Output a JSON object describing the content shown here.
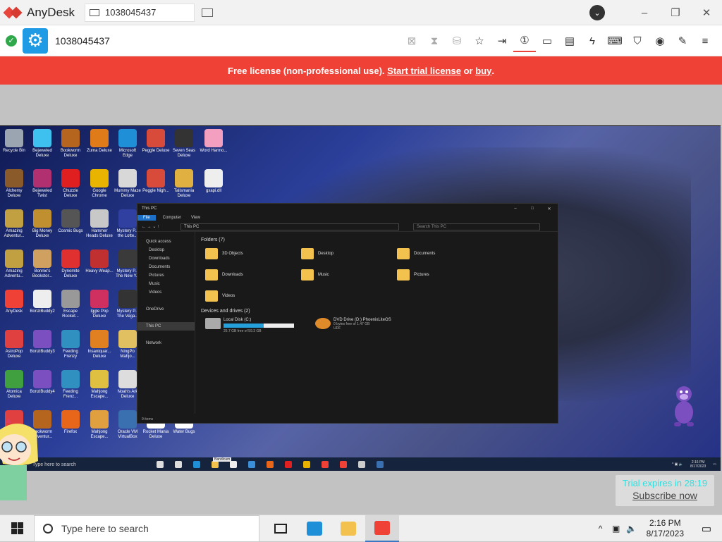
{
  "window": {
    "app_name": "AnyDesk",
    "tab_address": "1038045437",
    "profile_icon": "profile-icon",
    "controls": [
      "minimize-icon",
      "maximize-icon",
      "close-icon"
    ]
  },
  "toolbar": {
    "remote_id": "1038045437",
    "status_icon": "checkmark-icon",
    "tools": [
      {
        "name": "privacy-icon",
        "glyph": "⊠",
        "dim": true
      },
      {
        "name": "hourglass-icon",
        "glyph": "⧗",
        "dim": true
      },
      {
        "name": "database-icon",
        "glyph": "⛁",
        "dim": true
      },
      {
        "name": "favorite-star-icon",
        "glyph": "☆",
        "dim": false
      },
      {
        "name": "file-transfer-icon",
        "glyph": "⇥",
        "dim": false
      },
      {
        "name": "monitor-1-icon",
        "glyph": "①",
        "dim": false
      },
      {
        "name": "display-icon",
        "glyph": "▭",
        "dim": false
      },
      {
        "name": "chat-icon",
        "glyph": "▤",
        "dim": false
      },
      {
        "name": "actions-bolt-icon",
        "glyph": "ϟ",
        "dim": false
      },
      {
        "name": "keyboard-icon",
        "glyph": "⌨",
        "dim": false
      },
      {
        "name": "permissions-shield-icon",
        "glyph": "⛉",
        "dim": false
      },
      {
        "name": "record-icon",
        "glyph": "◉",
        "dim": false
      },
      {
        "name": "pen-icon",
        "glyph": "✎",
        "dim": false
      },
      {
        "name": "menu-icon",
        "glyph": "≡",
        "dim": false
      }
    ]
  },
  "banner": {
    "prefix": "Free license (non-professional use).",
    "trial_link": "Start trial license",
    "or": "or",
    "buy_link": "buy",
    "suffix": "."
  },
  "remote": {
    "desktop_icons": [
      {
        "label": "Recycle Bin",
        "color": "#9aa5b1"
      },
      {
        "label": "Bejeweled Deluxe",
        "color": "#3fc1f0"
      },
      {
        "label": "Bookworm Deluxe",
        "color": "#b5651d"
      },
      {
        "label": "Zuma Deluxe",
        "color": "#e07b1a"
      },
      {
        "label": "Microsoft Edge",
        "color": "#1f8fd8"
      },
      {
        "label": "Peggle Deluxe",
        "color": "#d84a3a"
      },
      {
        "label": "Seven Seas Deluxe",
        "color": "#333"
      },
      {
        "label": "Word Harmo...",
        "color": "#f3a0c0"
      },
      {
        "label": "Alchemy Deluxe",
        "color": "#8a5a2b"
      },
      {
        "label": "Bejeweled Twist",
        "color": "#b03070"
      },
      {
        "label": "Chuzzle Deluxe",
        "color": "#e02020"
      },
      {
        "label": "Google Chrome",
        "color": "#e8b400"
      },
      {
        "label": "Mummy Maze Deluxe",
        "color": "#d8d8d8"
      },
      {
        "label": "Peggle Nigh...",
        "color": "#d84a3a"
      },
      {
        "label": "Talismania Deluxe",
        "color": "#e0b040"
      },
      {
        "label": "gxapi.dll",
        "color": "#eeeeee"
      },
      {
        "label": "Amazing Adventur...",
        "color": "#c0a040"
      },
      {
        "label": "Big Money Deluxe",
        "color": "#c09030"
      },
      {
        "label": "Cosmic Bugs",
        "color": "#555"
      },
      {
        "label": "Hammer Heads Deluxe",
        "color": "#c8c8c8"
      },
      {
        "label": "Mystery P... the Lotte...",
        "color": "#3040a0"
      },
      {
        "label": "Amazing Adventu...",
        "color": "#c0a040"
      },
      {
        "label": "Bonnie's Bookstor...",
        "color": "#d0a060"
      },
      {
        "label": "Dynomite Deluxe",
        "color": "#e03030"
      },
      {
        "label": "Heavy Weap...",
        "color": "#c03030"
      },
      {
        "label": "Mystery P... The New Y...",
        "color": "#3a3a3a"
      },
      {
        "label": "AnyDesk",
        "color": "#ef4136"
      },
      {
        "label": "BonziBuddy2",
        "color": "#eeeeee"
      },
      {
        "label": "Escape Rocket...",
        "color": "#999"
      },
      {
        "label": "Iggle Pop Deluxe",
        "color": "#d03060"
      },
      {
        "label": "Mystery P... The Vega...",
        "color": "#333"
      },
      {
        "label": "AstroPop Deluxe",
        "color": "#e04040"
      },
      {
        "label": "BonziBuddy3",
        "color": "#7b4fc0"
      },
      {
        "label": "Feeding Frenzy",
        "color": "#3090c0"
      },
      {
        "label": "Insaniquar... Deluxe",
        "color": "#e08020"
      },
      {
        "label": "NingPo Mahjo...",
        "color": "#e0c060"
      },
      {
        "label": "Atomica Deluxe",
        "color": "#40a040"
      },
      {
        "label": "BonziBuddy4",
        "color": "#7b4fc0"
      },
      {
        "label": "Feeding Frenz...",
        "color": "#3090c0"
      },
      {
        "label": "Mahjong Escape...",
        "color": "#e0c040"
      },
      {
        "label": "Noah's Ark Deluxe",
        "color": "#ddd"
      },
      {
        "label": "",
        "color": "#e04040"
      },
      {
        "label": "Bookworm Adventur...",
        "color": "#b5651d"
      },
      {
        "label": "Firefox",
        "color": "#e8661a"
      },
      {
        "label": "Mahjong Escape...",
        "color": "#e0a040"
      },
      {
        "label": "Oracle VM VirtualBox",
        "color": "#3a6fb0"
      },
      {
        "label": "Rocket Mania Deluxe",
        "color": "#ffffff"
      },
      {
        "label": "Water Bugs",
        "color": "#ffffff"
      }
    ],
    "explorer": {
      "title": "This PC",
      "ribbon": [
        "File",
        "Computer",
        "View"
      ],
      "path": "This PC",
      "search_placeholder": "Search This PC",
      "nav": [
        {
          "label": "Quick access",
          "sub": false,
          "on": false
        },
        {
          "label": "Desktop",
          "sub": true,
          "on": false
        },
        {
          "label": "Downloads",
          "sub": true,
          "on": false
        },
        {
          "label": "Documents",
          "sub": true,
          "on": false
        },
        {
          "label": "Pictures",
          "sub": true,
          "on": false
        },
        {
          "label": "Music",
          "sub": true,
          "on": false
        },
        {
          "label": "Videos",
          "sub": true,
          "on": false
        },
        {
          "label": "",
          "sub": false,
          "on": false
        },
        {
          "label": "OneDrive",
          "sub": false,
          "on": false
        },
        {
          "label": "",
          "sub": false,
          "on": false
        },
        {
          "label": "This PC",
          "sub": false,
          "on": true
        },
        {
          "label": "",
          "sub": false,
          "on": false
        },
        {
          "label": "Network",
          "sub": false,
          "on": false
        }
      ],
      "folders_header": "Folders (7)",
      "folders": [
        "3D Objects",
        "Desktop",
        "Documents",
        "Downloads",
        "Music",
        "Pictures",
        "Videos"
      ],
      "drives_header": "Devices and drives (2)",
      "drives": [
        {
          "name": "Local Disk (C:)",
          "detail": "25.7 GB free of 59.3 GB",
          "fill": 0.57,
          "dvd": false
        },
        {
          "name": "DVD Drive (D:) PhoenixLiteOS",
          "detail": "0 bytes free of 1.47 GB",
          "detail2": "UDF",
          "fill": null,
          "dvd": true
        }
      ],
      "status": "9 items"
    },
    "taskbar": {
      "search": "Type here to search",
      "tooltip": "Bandicam",
      "time": "2:16 PM",
      "date": "8/17/2023",
      "apps": [
        "#ddd",
        "#ddd",
        "#1f8fd8",
        "#f2c14e",
        "#eee",
        "#3a8fd8",
        "#e8661a",
        "#e02020",
        "#e8b400",
        "#ef4136",
        "#ef4136",
        "#ccc",
        "#3a6fb0"
      ]
    }
  },
  "trial": {
    "text": "Trial expires in 28:19",
    "link": "Subscribe now"
  },
  "taskbar": {
    "search_placeholder": "Type here to search",
    "time": "2:16 PM",
    "date": "8/17/2023",
    "apps": [
      {
        "name": "task-view-icon",
        "color": "#222",
        "active": false,
        "hl": false
      },
      {
        "name": "edge-icon",
        "color": "#1f8fd8",
        "active": false,
        "hl": false
      },
      {
        "name": "file-explorer-icon",
        "color": "#f2c14e",
        "active": false,
        "hl": false
      },
      {
        "name": "anydesk-icon",
        "color": "#ef4136",
        "active": true,
        "hl": true
      }
    ]
  },
  "colors": {
    "banner": "#ef4136",
    "accent": "#1f9be6",
    "trial_text": "#2ee0df"
  }
}
